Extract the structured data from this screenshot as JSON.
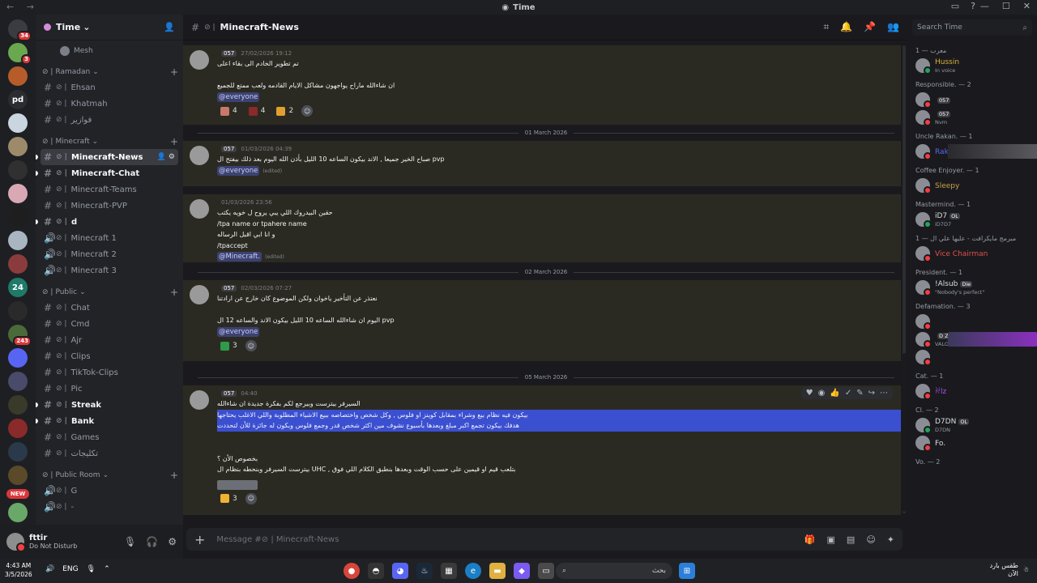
{
  "window": {
    "title": "Time",
    "nav": "← →"
  },
  "servers": {
    "badges": {
      "top": "34",
      "s2": "3",
      "s3": "243",
      "new": "NEW"
    },
    "icons": [
      {
        "name": "discord-home",
        "bg": "#3a3c42"
      },
      {
        "name": "server-2",
        "bg": "#6aa84f"
      },
      {
        "name": "server-3",
        "bg": "#b65c2a"
      },
      {
        "name": "server-pd",
        "bg": "#2b2d31",
        "text": "pd"
      },
      {
        "name": "server-5",
        "bg": "#c9d6df"
      },
      {
        "name": "server-6",
        "bg": "#9c8a6a"
      },
      {
        "name": "server-7",
        "bg": "#303030"
      },
      {
        "name": "server-8",
        "bg": "#d8a9b5"
      },
      {
        "name": "server-9",
        "bg": "#1e1e1e"
      },
      {
        "name": "server-10",
        "bg": "#a9b6c2"
      },
      {
        "name": "server-11",
        "bg": "#8a3c3c"
      },
      {
        "name": "server-12",
        "bg": "#1f7a6a",
        "text": "24"
      },
      {
        "name": "server-13",
        "bg": "#2a2a2a"
      },
      {
        "name": "server-14",
        "bg": "#4a6a3a"
      },
      {
        "name": "server-15",
        "bg": "#5865f2"
      },
      {
        "name": "server-16",
        "bg": "#4a4a6a"
      },
      {
        "name": "server-17",
        "bg": "#3a3a2a"
      },
      {
        "name": "server-18",
        "bg": "#8a2a2a"
      },
      {
        "name": "server-19",
        "bg": "#2a3a4a"
      },
      {
        "name": "server-20",
        "bg": "#5a4a2a"
      },
      {
        "name": "server-21",
        "bg": "#6aa86a"
      }
    ]
  },
  "guild": {
    "name": "Time"
  },
  "channels": {
    "voice_user": "Mesh",
    "categories": [
      {
        "name": "Ramadan",
        "items": [
          {
            "name": "Ehsan",
            "type": "text",
            "bold": false
          },
          {
            "name": "Khatmah",
            "type": "text",
            "bold": false
          },
          {
            "name": "فوازير",
            "type": "text",
            "bold": false
          }
        ]
      },
      {
        "name": "Minecraft",
        "items": [
          {
            "name": "Minecraft-News",
            "type": "text",
            "bold": true,
            "active": true
          },
          {
            "name": "Minecraft-Chat",
            "type": "text",
            "bold": true
          },
          {
            "name": "Minecraft-Teams",
            "type": "text",
            "bold": false
          },
          {
            "name": "Minecraft-PVP",
            "type": "text",
            "bold": false
          },
          {
            "name": "d",
            "type": "text",
            "bold": true
          },
          {
            "name": "Minecraft 1",
            "type": "voice",
            "bold": false
          },
          {
            "name": "Minecraft 2",
            "type": "voice",
            "bold": false
          },
          {
            "name": "Minecraft 3",
            "type": "voice",
            "bold": false
          }
        ]
      },
      {
        "name": "Public",
        "items": [
          {
            "name": "Chat",
            "type": "text",
            "bold": false
          },
          {
            "name": "Cmd",
            "type": "text",
            "bold": false
          },
          {
            "name": "Ajr",
            "type": "text",
            "bold": false
          },
          {
            "name": "Clips",
            "type": "text",
            "bold": false
          },
          {
            "name": "TikTok-Clips",
            "type": "text",
            "bold": false
          },
          {
            "name": "Pic",
            "type": "text",
            "bold": false
          },
          {
            "name": "Streak",
            "type": "text",
            "bold": true
          },
          {
            "name": "Bank",
            "type": "text",
            "bold": true
          },
          {
            "name": "Games",
            "type": "text",
            "bold": false
          },
          {
            "name": "تكليجات",
            "type": "text",
            "bold": false
          }
        ]
      },
      {
        "name": "Public Room",
        "items": [
          {
            "name": "G",
            "type": "voice",
            "bold": false
          },
          {
            "name": "-",
            "type": "voice",
            "bold": false
          }
        ]
      }
    ]
  },
  "user": {
    "name": "fttir",
    "status": "Do Not Disturb"
  },
  "chat": {
    "channel_name": "Minecraft-News",
    "search_placeholder": "Search Time",
    "composer_placeholder": "Message #⊘ | Minecraft-News",
    "messages": [
      {
        "id": "m1",
        "tag": "057",
        "time": "27/02/2026 19:12",
        "lines": [
          "تم تطوير الخادم الى بقاء اعلى",
          "",
          "ان شاءالله ماراح يواجهون مشاكل الايام القادمه ولعب ممتع للجميع"
        ],
        "mention": "@everyone",
        "edited": "",
        "reactions": [
          {
            "count": "4",
            "color": "#c77a6a"
          },
          {
            "count": "4",
            "color": "#8a2a2a"
          },
          {
            "count": "2",
            "color": "#e0a030"
          }
        ]
      },
      {
        "id": "m2",
        "tag": "057",
        "time": "01/03/2026 04:39",
        "lines": [
          "صباح الخير جميعا , الاند بيكون الساعه 10 الليل بأذن الله اليوم بعد ذلك بيفتح ال pvp"
        ],
        "mention": "@everyone",
        "edited": "(edited)",
        "reactions": []
      },
      {
        "id": "m3",
        "tag": "",
        "time": "01/03/2026 23:56",
        "lines": [
          "حقين البيدروك اللي يبي يروح ل خويه يكتب",
          "/tpa name or tpahere name",
          "و انا ابي اقبل الرساله",
          "/tpaccept"
        ],
        "mention": "@Minecraft.",
        "edited": "(edited)",
        "reactions": []
      },
      {
        "id": "m4",
        "tag": "057",
        "time": "02/03/2026 07:27",
        "lines": [
          "نعتذر عن التأخير ياخوان ولكن الموضوع كان خارج عن ارادتنا",
          "",
          "اليوم ان شاءالله الساعه 10 الليل بيكون الاند والساعه 12 ال pvp"
        ],
        "mention": "@everyone",
        "edited": "",
        "reactions": [
          {
            "count": "3",
            "color": "#2e9a4a"
          }
        ]
      },
      {
        "id": "m5",
        "tag": "057",
        "time": "04:40",
        "lines": [
          "السيرفر بيترست وبيرجع لكم بفكرة جديدة ان شاءالله",
          "بيكون فيه نظام بيع وشراء بمقابل كوينز او فلوس , وكل شخص واختصاصه ببيع الاشياء المطلوبة واللي الاغلب يحتاجها",
          "هدفك بيكون تجمع اكبر مبلغ وبعدها بأسبوع نشوف مين اكثر شخص قدر وجمع فلوس وبكون له جائزة للأن لتحددت",
          "",
          "",
          "بخصوص الأن ؟",
          "بيترست السيرفر وبنحطه بنظام ال UHC , بتلعب قيم او قيمين على حسب الوقت وبعدها بنطبق الكلام اللي فوق"
        ],
        "mention": "",
        "edited": "",
        "reactions": [
          {
            "count": "3",
            "color": "#f0b232"
          }
        ]
      }
    ],
    "dates": [
      "01 March 2026",
      "02 March 2026",
      "05 March 2026"
    ]
  },
  "members": [
    {
      "group": "معرب — 1",
      "users": [
        {
          "name": "Hussin",
          "sub": "In voice",
          "online": true,
          "color": "#d4b23a"
        }
      ]
    },
    {
      "group": "Responsible. — 2",
      "users": [
        {
          "name": "",
          "tag": "057",
          "sub": "",
          "online": false
        },
        {
          "name": "",
          "tag": "057",
          "sub": "Nvm",
          "online": false
        }
      ]
    },
    {
      "group": "Uncle Rakan. — 1",
      "users": [
        {
          "name": "Rakan",
          "sub": "",
          "online": false,
          "color": "#5865f2"
        }
      ]
    },
    {
      "group": "Coffee Enjoyer. — 1",
      "users": [
        {
          "name": "Sleepy",
          "sub": "",
          "online": false,
          "color": "#c9a04a"
        }
      ]
    },
    {
      "group": "Mastermind. — 1",
      "users": [
        {
          "name": "iD7",
          "tag": "OL",
          "sub": "iD7D7",
          "online": true,
          "color": "#dbdee1"
        }
      ]
    },
    {
      "group": "مبرمج مايكرافت - عليها علي ال — 1",
      "users": [
        {
          "name": "Vice Chairman",
          "sub": "",
          "online": false,
          "color": "#e0504a"
        }
      ]
    },
    {
      "group": "President. — 1",
      "users": [
        {
          "name": "!Alsub",
          "tag": "Die",
          "sub": "\"Nobody's perfect\"",
          "online": false,
          "color": "#dbdee1"
        }
      ]
    },
    {
      "group": "Defamation. — 3",
      "users": [
        {
          "name": "",
          "sub": "",
          "online": false
        },
        {
          "name": "",
          "tag": "D Z",
          "sub": "VALORANT",
          "online": false
        },
        {
          "name": "",
          "sub": "",
          "online": false
        }
      ]
    },
    {
      "group": "Cat. — 1",
      "users": [
        {
          "name": "ꋊlz",
          "sub": "",
          "online": false,
          "color": "#a855f7"
        }
      ]
    },
    {
      "group": "Cl. — 2",
      "users": [
        {
          "name": "D7DN",
          "tag": "OL",
          "sub": "D7DN",
          "online": true,
          "color": "#dbdee1"
        },
        {
          "name": "Fo.",
          "sub": "",
          "online": false,
          "color": "#dbdee1"
        }
      ]
    },
    {
      "group": "Vo. — 2",
      "users": []
    }
  ],
  "taskbar": {
    "time": "4:43 AM",
    "date": "3/5/2026",
    "lang": "ENG",
    "search_text": "بحث",
    "weather_text": "طقس بارد",
    "weather_sub": "الآن"
  }
}
